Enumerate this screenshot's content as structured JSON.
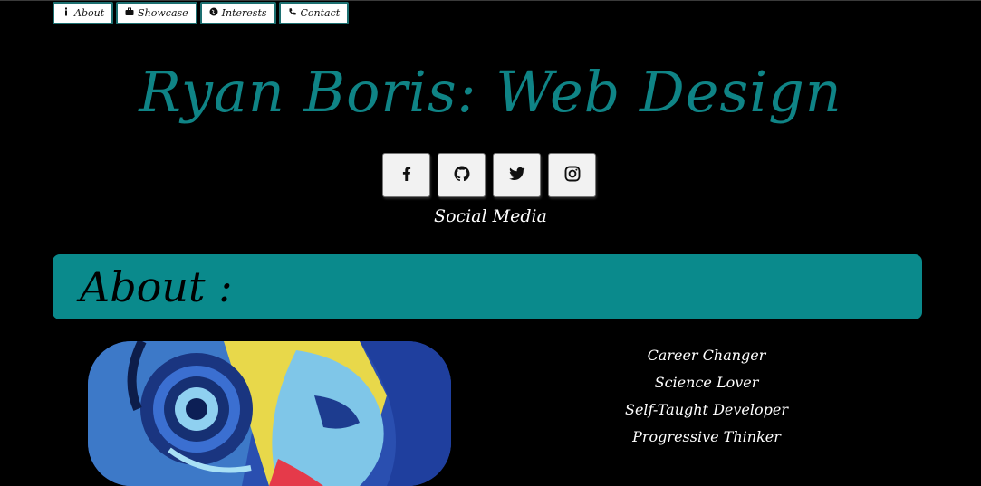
{
  "nav": {
    "items": [
      {
        "label": "About",
        "icon": "info-icon"
      },
      {
        "label": "Showcase",
        "icon": "briefcase-icon"
      },
      {
        "label": "Interests",
        "icon": "globe-icon"
      },
      {
        "label": "Contact",
        "icon": "phone-icon"
      }
    ]
  },
  "header": {
    "title": "Ryan Boris: Web Design"
  },
  "social": {
    "label": "Social Media",
    "buttons": [
      {
        "icon": "facebook-icon"
      },
      {
        "icon": "github-icon"
      },
      {
        "icon": "twitter-icon"
      },
      {
        "icon": "instagram-icon"
      }
    ]
  },
  "about": {
    "heading": "About :",
    "traits": [
      "Career Changer",
      "Science Lover",
      "Self-Taught Developer",
      "Progressive Thinker"
    ]
  },
  "colors": {
    "accent": "#0a8a8c",
    "title": "#0f8486",
    "background": "#000000"
  }
}
